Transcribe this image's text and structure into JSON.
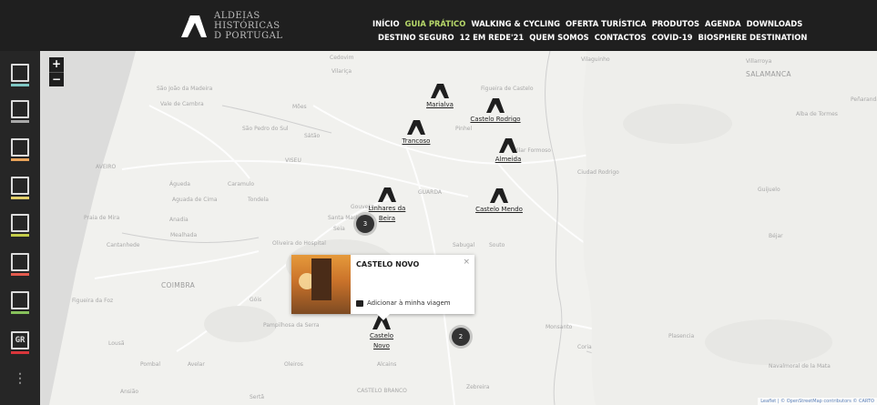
{
  "logo": {
    "lines": [
      "ALDEIAS",
      "HISTÓRICAS",
      "D PORTUGAL"
    ]
  },
  "nav": {
    "row1": [
      "INÍCIO",
      "GUIA PRÁTICO",
      "WALKING & CYCLING",
      "OFERTA TURÍSTICA",
      "PRODUTOS",
      "AGENDA",
      "DOWNLOADS"
    ],
    "row2": [
      "DESTINO SEGURO",
      "12 EM REDE'21",
      "QUEM SOMOS",
      "CONTACTOS",
      "COVID-19",
      "BIOSPHERE DESTINATION"
    ],
    "active": "GUIA PRÁTICO"
  },
  "sidebar": [
    {
      "icon": "pillar-icon",
      "glyph": "",
      "color": "#7fc7c4"
    },
    {
      "icon": "castle-icon",
      "glyph": "",
      "color": "#a8a8a8"
    },
    {
      "icon": "bed-icon",
      "glyph": "",
      "color": "#e8a35a"
    },
    {
      "icon": "shop-icon",
      "glyph": "",
      "color": "#e2cf6a"
    },
    {
      "icon": "hiker-icon",
      "glyph": "",
      "color": "#c4cd4a"
    },
    {
      "icon": "info-icon",
      "glyph": "",
      "color": "#e35a4d"
    },
    {
      "icon": "event-icon",
      "glyph": "",
      "color": "#86c05a"
    },
    {
      "icon": "gr-trail-icon",
      "glyph": "GR",
      "color": "#d8353a"
    },
    {
      "icon": "more-icon",
      "glyph": "⋮",
      "color": ""
    }
  ],
  "zoom": {
    "in": "+",
    "out": "−"
  },
  "places": [
    "Cedovim",
    "Vilariça",
    "Vilaguinho",
    "Villarroya",
    "SALAMANCA",
    "São João da Madeira",
    "Vale de Cambra",
    "Mões",
    "Figueira de Castelo",
    "Peñaranda Bracamonte",
    "Alba de Tormes",
    "São Pedro do Sul",
    "Sátão",
    "Pinhel",
    "VISEU",
    "AVEIRO",
    "Vilar Formoso",
    "Ciudad Rodrigo",
    "Guijuelo",
    "Águeda",
    "Caramulo",
    "Aguada de Cima",
    "Tondela",
    "GUARDA",
    "Praia de Mira",
    "Anadia",
    "Gouveia",
    "Santa Marinha",
    "Seia",
    "Béjar",
    "Mealhada",
    "Cantanhede",
    "Oliveira do Hospital",
    "Sabugal",
    "Souto",
    "COIMBRA",
    "Figueira da Foz",
    "Góis",
    "Pampilhosa da Serra",
    "Monsanto",
    "Plasencia",
    "Lousã",
    "Coria",
    "Pombal",
    "Avelar",
    "Oleiros",
    "Alcains",
    "Navalmoral de la Mata",
    "Ansião",
    "Sertã",
    "CASTELO BRANCO",
    "Zebreira"
  ],
  "markers": [
    {
      "label": "Marialva"
    },
    {
      "label": "Castelo Rodrigo"
    },
    {
      "label": "Trancoso"
    },
    {
      "label": "Almeida"
    },
    {
      "label": "Castelo Mendo"
    },
    {
      "label": "Linhares da Beira"
    },
    {
      "label": "Castelo Novo"
    }
  ],
  "clusters": [
    "3",
    "2"
  ],
  "popup": {
    "title": "CASTELO NOVO",
    "close": "×",
    "add": "Adicionar à minha viagem"
  },
  "attribution": "Leaflet | © OpenStreetMap contributors © CARTO"
}
